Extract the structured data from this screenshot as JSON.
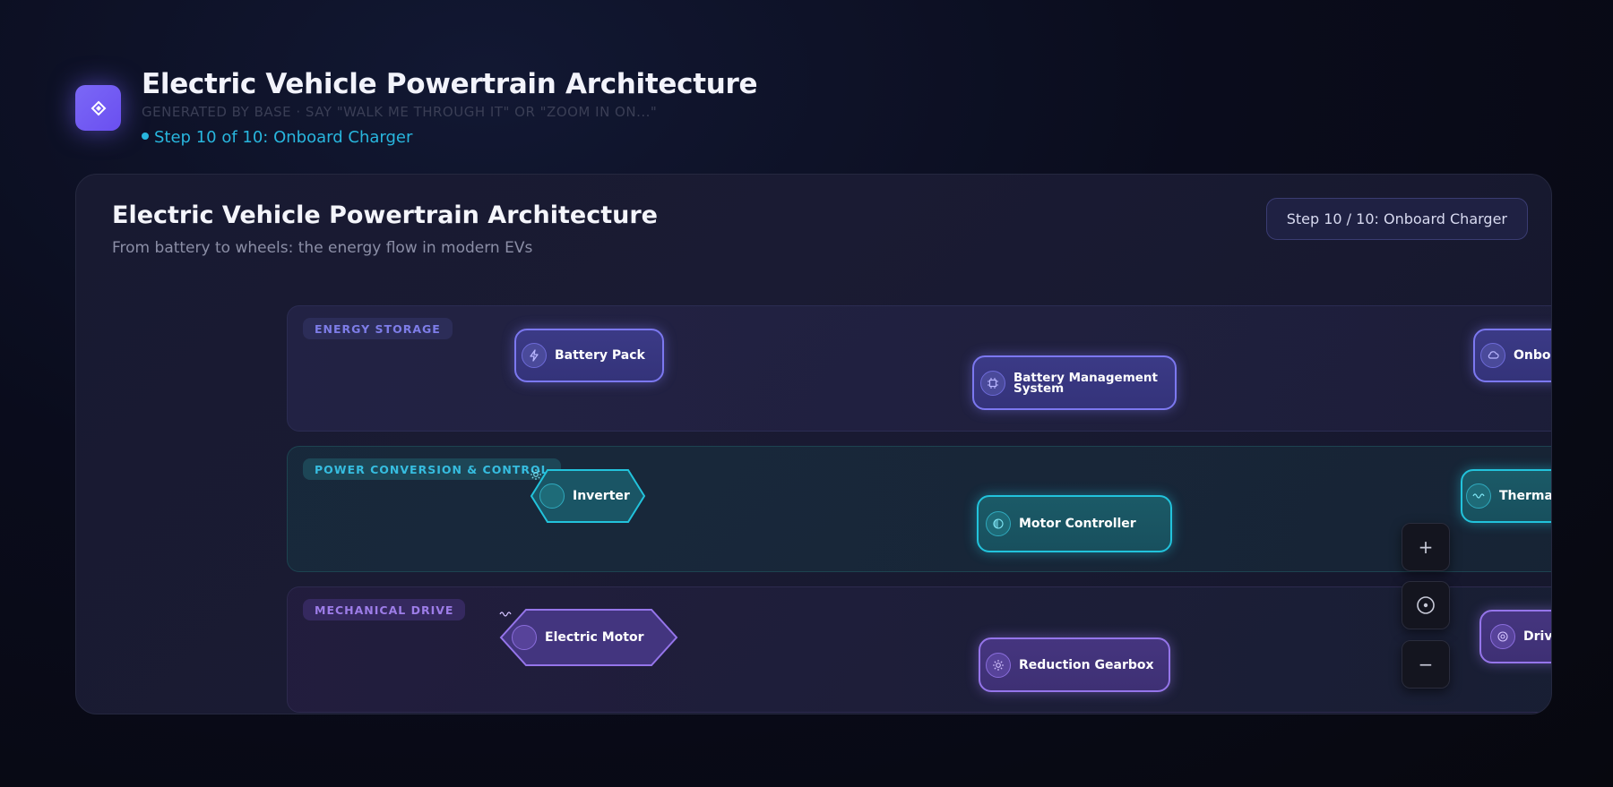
{
  "header": {
    "title": "Electric Vehicle Powertrain Architecture",
    "subtitle": "GENERATED BY BASE · SAY \"WALK ME THROUGH IT\" OR \"ZOOM IN ON...\"",
    "step": "Step 10 of 10: Onboard Charger",
    "logo_icon": "diamond-icon"
  },
  "diagram": {
    "title": "Electric Vehicle Powertrain Architecture",
    "subtitle": "From battery to wheels: the energy flow in modern EVs",
    "step_pill": "Step 10 / 10: Onboard Charger"
  },
  "lanes": {
    "energy": {
      "label": "ENERGY STORAGE"
    },
    "power": {
      "label": "POWER CONVERSION & CONTROL"
    },
    "mech": {
      "label": "MECHANICAL DRIVE"
    }
  },
  "nodes": {
    "battery_pack": {
      "label": "Battery Pack",
      "icon": "lightning-icon"
    },
    "bms": {
      "label_line1": "Battery Management",
      "label_line2": "System",
      "icon": "chip-icon"
    },
    "onboard_charger": {
      "label": "Onboard",
      "icon": "cloud-icon"
    },
    "inverter": {
      "label": "Inverter",
      "icon": "sun-icon"
    },
    "motor_controller": {
      "label": "Motor Controller",
      "icon": "half-circle-icon"
    },
    "thermal": {
      "label": "Thermal I",
      "icon": "wave-icon"
    },
    "electric_motor": {
      "label": "Electric Motor",
      "icon": "wave-icon"
    },
    "reduction_gearbox": {
      "label": "Reduction Gearbox",
      "icon": "gear-icon"
    },
    "drive": {
      "label": "Drive",
      "icon": "target-icon"
    }
  },
  "zoom": {
    "zoom_in": "+",
    "zoom_out": "−"
  },
  "colors": {
    "energy": "#7c78f0",
    "power": "#22c3dc",
    "mech": "#9575ea",
    "accent": "#28b6de"
  }
}
